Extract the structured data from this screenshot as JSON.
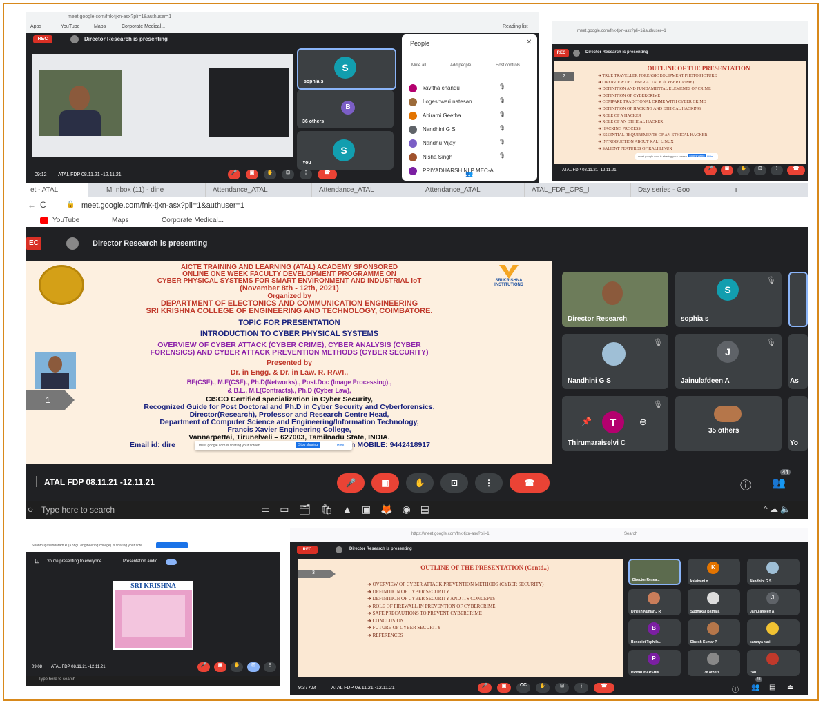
{
  "tl": {
    "url": "meet.google.com/fnk-tjxn-asx?pli=1&authuser=1",
    "bookmarks": [
      "Apps",
      "YouTube",
      "Maps",
      "Corporate Medical..."
    ],
    "reading_list": "Reading list",
    "rec": "REC",
    "presenting": "Director Research is presenting",
    "time": "09:12",
    "meeting": "ATAL FDP 08.11.21 -12.11.21",
    "tiles": [
      {
        "name": "sophia s",
        "initial": "S"
      },
      {
        "name": "36 others",
        "initial": "B"
      },
      {
        "name": "You",
        "initial": "S"
      }
    ],
    "people": {
      "title": "People",
      "actions": [
        "Mute all",
        "Add people",
        "Host controls"
      ],
      "rows": [
        "kavitha chandu",
        "Logeshwari natesan",
        "Abirami Geetha",
        "Nandhini G S",
        "Nandhu Vijay",
        "Nisha Singh",
        "PRIYADHARSHINI P MEC-A"
      ]
    }
  },
  "tr": {
    "url": "meet.google.com/fnk-tjxn-asx?pli=1&authuser=1",
    "rec": "REC",
    "presenting": "Director Research is presenting",
    "meeting": "ATAL FDP 08.11.21 -12.11.21",
    "slide_num": "2",
    "title": "OUTLINE OF THE PRESENTATION",
    "items": [
      "TRUE TRAVELLER FORENSIC EQUIPMENT PHOTO PICTURE",
      "OVERVIEW OF CYBER ATTACK (CYBER CRIME)",
      "DEFINITION AND FUNDAMENTAL ELEMENTS OF CRIME",
      "DEFINITION OF CYBERCRIME",
      "COMPARE TRADITIONAL CRIME WITH CYBER CRIME",
      "DEFINITION OF HACKING AND ETHICAL HACKING",
      "ROLE OF A HACKER",
      "ROLE OF AN ETHICAL HACKER",
      "HACKING PROCESS",
      "ESSENTIAL REQUIREMENTS OF AN ETHICAL HACKER",
      "INTRODUCTION ABOUT KALI LINUX",
      "SALIENT FEATURES OF KALI LINUX"
    ],
    "share_bar": "meet.google.com is sharing your screen.",
    "stop": "Stop sharing",
    "hide": "Hide"
  },
  "mid": {
    "tabs": [
      "et - ATAL",
      "M Inbox (11) - dine",
      "Attendance_ATAL",
      "Attendance_ATAL",
      "Attendance_ATAL",
      "ATAL_FDP_CPS_I",
      "Day series - Goo"
    ],
    "url": "meet.google.com/fnk-tjxn-asx?pli=1&authuser=1",
    "bookmarks": [
      "YouTube",
      "Maps",
      "Corporate Medical..."
    ],
    "rec": "EC",
    "presenting": "Director Research is presenting",
    "meeting": "ATAL FDP 08.11.21 -12.11.21",
    "slide_num": "1",
    "logo_text": "SRI KRISHNA INSTITUTIONS",
    "slide_lines": [
      "AICTE TRAINING AND LEARNING (ATAL) ACADEMY SPONSORED",
      "ONLINE ONE WEEK FACULTY DEVELOPMENT PROGRAMME ON",
      "CYBER PHYSICAL SYSTEMS FOR SMART ENVIRONMENT AND INDUSTRIAL IoT",
      "(November 8th - 12th, 2021)",
      "Organized by",
      "DEPARTMENT OF ELECTONICS AND COMMUNICATION ENGINEERING",
      "SRI KRISHNA COLLEGE OF ENGINEERING AND TECHNOLOGY, COIMBATORE.",
      "TOPIC FOR PRESENTATION",
      "INTRODUCTION TO CYBER PHYSICAL SYSTEMS",
      "OVERVIEW OF CYBER ATTACK (CYBER CRIME), CYBER ANALYSIS (CYBER",
      "FORENSICS) AND CYBER ATTACK PREVENTION METHODS (CYBER SECURITY)",
      "Presented by",
      "Dr. in Engg. & Dr. in Law. R. RAVI.,",
      "BE(CSE)., M.E(CSE)., Ph.D(Networks)., Post.Doc (Image Processing).,",
      "& B.L., M.L(Contracts)., Ph.D (Cyber Law),",
      "CISCO Certified specialization in Cyber Security,",
      "Recognized Guide for Post Doctoral and Ph.D in Cyber Security and Cyberforensics,",
      "Director(Research), Professor and Research Centre Head,",
      "Department of Computer Science and Engineering/Information Technology,",
      "Francis Xavier Engineering College,",
      "Vannarpettai, Tirunelveli – 627003, Tamilnadu State, INDIA.",
      "Email id: dire",
      "n MOBILE: 9442418917"
    ],
    "share_bar": "meet.google.com is sharing your screen.",
    "stop": "Stop sharing",
    "hide": "Hide",
    "tiles": [
      {
        "name": "Director Research",
        "initial": ""
      },
      {
        "name": "sophia s",
        "initial": "S"
      },
      {
        "name": "Nandhini G S",
        "initial": ""
      },
      {
        "name": "Jainulafdeen A",
        "initial": "J"
      },
      {
        "name": "As",
        "initial": ""
      },
      {
        "name": "Thirumaraiselvi C",
        "initial": "T"
      },
      {
        "name": "35 others",
        "initial": ""
      },
      {
        "name": "Yo",
        "initial": ""
      }
    ],
    "people_count": "44",
    "search": "Type here to search"
  },
  "bl": {
    "notice": "Shanmugasundaram R (Kongu engineering college) is sharing your screen",
    "you_presenting": "You're presenting to everyone",
    "audio": "Presentation audio",
    "poster_title": "SRI KRISHNA",
    "time": "09:08",
    "meeting": "ATAL FDP 08.11.21 -12.11.21",
    "search": "Type here to search"
  },
  "br": {
    "url": "https://meet.google.com/fnk-tjxn-asx?pli=1",
    "search": "Search",
    "rec": "REC",
    "presenting": "Director Research is presenting",
    "slide_num": "3",
    "title": "OUTLINE OF THE PRESENTATION (Contd..)",
    "items": [
      "OVERVIEW OF CYBER ATTACK PREVENTION METHODS (CYBER SECURITY)",
      "DEFINITION OF CYBER SECURITY",
      "DEFINITION OF CYBER SECURITY AND ITS CONCEPTS",
      "ROLE OF FIREWALL IN PREVENTION OF CYBERCRIME",
      "SAFE PRECAUTIONS TO PREVENT CYBERCRIME",
      "CONCLUSION",
      "FUTURE OF CYBER SECURITY",
      "REFERENCES"
    ],
    "time": "9:37 AM",
    "meeting": "ATAL FDP 08.11.21 -12.11.21",
    "tiles": [
      {
        "name": "Director Resea...",
        "initial": ""
      },
      {
        "name": "kalaivani n",
        "initial": "K"
      },
      {
        "name": "Nandhini G S",
        "initial": ""
      },
      {
        "name": "Dinesh Kumar J R",
        "initial": ""
      },
      {
        "name": "Sudhakar Bathala",
        "initial": ""
      },
      {
        "name": "Jainulafdeen A",
        "initial": "J"
      },
      {
        "name": "Benedict Tephila...",
        "initial": "B"
      },
      {
        "name": "Dinesh Kumar P",
        "initial": ""
      },
      {
        "name": "saranya rani",
        "initial": ""
      },
      {
        "name": "PRIYADHARSHIN...",
        "initial": "P"
      },
      {
        "name": "38 others",
        "initial": ""
      },
      {
        "name": "You",
        "initial": ""
      }
    ],
    "people_count": "43"
  }
}
